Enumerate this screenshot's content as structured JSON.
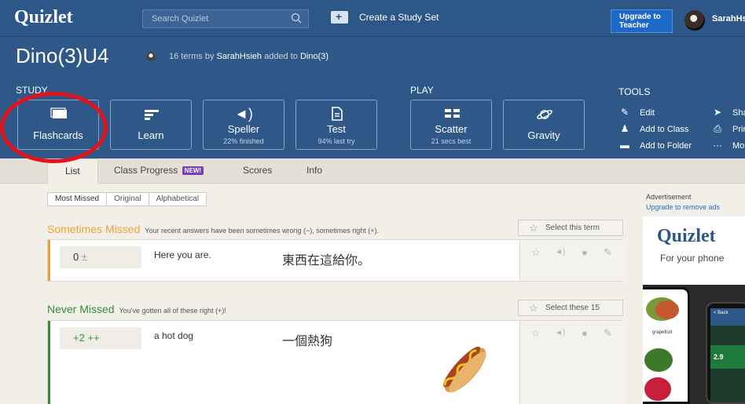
{
  "topbar": {
    "logo": "Quizlet",
    "search_placeholder": "Search Quizlet",
    "create_label": "Create a Study Set",
    "upgrade_label": "Upgrade to Teacher",
    "username": "SarahHsieh"
  },
  "set": {
    "title": "Dino(3)U4",
    "meta_prefix": "16 terms by",
    "author": "SarahHsieh",
    "meta_middle": "added to",
    "folder": "Dino(3)"
  },
  "sections": {
    "study": "STUDY",
    "play": "PLAY",
    "tools": "TOOLS"
  },
  "modes": {
    "flashcards": {
      "label": "Flashcards"
    },
    "learn": {
      "label": "Learn"
    },
    "speller": {
      "label": "Speller",
      "sub": "22% finished"
    },
    "test": {
      "label": "Test",
      "sub": "94% last try"
    },
    "scatter": {
      "label": "Scatter",
      "sub": "21 secs best"
    },
    "gravity": {
      "label": "Gravity"
    }
  },
  "tools": {
    "edit": "Edit",
    "add_class": "Add to Class",
    "add_folder": "Add to Folder",
    "share": "Share",
    "print": "Print",
    "more": "More"
  },
  "tabs": {
    "list": "List",
    "class_progress": "Class Progress",
    "new_badge": "NEW!",
    "scores": "Scores",
    "info": "Info"
  },
  "sort": {
    "most_missed": "Most Missed",
    "original": "Original",
    "alphabetical": "Alphabetical"
  },
  "groups": {
    "sometimes": {
      "title": "Sometimes Missed",
      "desc": "Your recent answers have been sometimes wrong (−), sometimes right (+).",
      "select": "Select this term",
      "color": "#e8a43a"
    },
    "never": {
      "title": "Never Missed",
      "desc": "You've gotten all of these right (+)!",
      "select": "Select these 15",
      "color": "#3a8a3a"
    }
  },
  "terms": [
    {
      "score": "0",
      "marks": "±",
      "word": "Here you are.",
      "definition": "東西在這給你。"
    },
    {
      "score": "+2",
      "marks": "++",
      "word": "a hot dog",
      "definition": "一個熱狗"
    }
  ],
  "ad": {
    "label": "Advertisement",
    "link": "Upgrade to remove ads",
    "logo": "Quizlet",
    "tagline": "For your phone",
    "fruit_label": "grapefruit",
    "phone_back": "< Back",
    "phone_value": "2.9"
  },
  "icons": {
    "search": "search-icon",
    "flashcards": "flashcards-icon",
    "learn": "learn-icon",
    "speller": "speaker-icon",
    "test": "document-icon",
    "scatter": "grid-icon",
    "gravity": "planet-icon"
  },
  "colors": {
    "brand": "#2e5789",
    "annotation": "#e3131d"
  }
}
